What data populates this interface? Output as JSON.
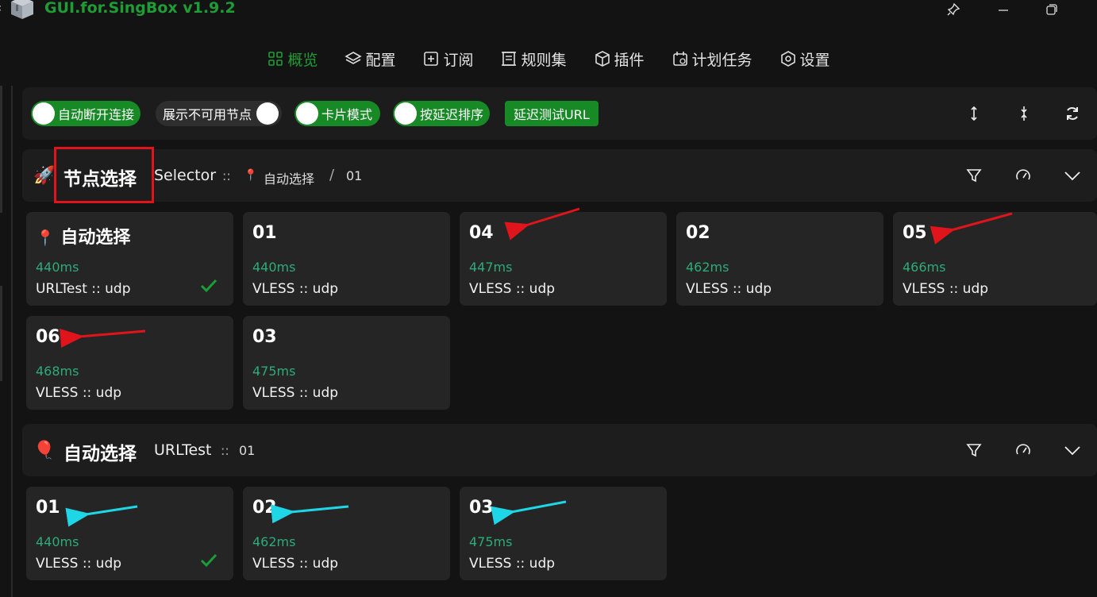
{
  "window": {
    "title": "GUI.for.SingBox v1.9.2"
  },
  "nav": {
    "items": [
      {
        "label": "概览",
        "active": true
      },
      {
        "label": "配置"
      },
      {
        "label": "订阅"
      },
      {
        "label": "规则集"
      },
      {
        "label": "插件"
      },
      {
        "label": "计划任务"
      },
      {
        "label": "设置"
      }
    ]
  },
  "toolbar": {
    "auto_disconnect": {
      "label": "自动断开连接",
      "on": true
    },
    "show_unavailable": {
      "label": "展示不可用节点",
      "on": false
    },
    "card_mode": {
      "label": "卡片模式",
      "on": true
    },
    "sort_by_delay": {
      "label": "按延迟排序",
      "on": true
    },
    "delay_test_url": "延迟测试URL"
  },
  "groups": [
    {
      "emoji": "🚀",
      "name": "节点选择",
      "type": "Selector",
      "separator": "::",
      "crumb_emoji": "📍",
      "crumb_group": "自动选择",
      "crumb_slash": "/",
      "crumb_node": "01",
      "cards": [
        {
          "emoji": "📍",
          "name": "自动选择",
          "delay": "440ms",
          "type": "URLTest :: udp",
          "selected": true
        },
        {
          "name": "01",
          "delay": "440ms",
          "type": "VLESS :: udp"
        },
        {
          "name": "04",
          "delay": "447ms",
          "type": "VLESS :: udp"
        },
        {
          "name": "02",
          "delay": "462ms",
          "type": "VLESS :: udp"
        },
        {
          "name": "05",
          "delay": "466ms",
          "type": "VLESS :: udp"
        },
        {
          "name": "06",
          "delay": "468ms",
          "type": "VLESS :: udp"
        },
        {
          "name": "03",
          "delay": "475ms",
          "type": "VLESS :: udp"
        }
      ]
    },
    {
      "emoji": "🎈",
      "name": "自动选择",
      "type": "URLTest",
      "separator": "::",
      "crumb_node": "01",
      "cards": [
        {
          "name": "01",
          "delay": "440ms",
          "type": "VLESS :: udp",
          "selected": true
        },
        {
          "name": "02",
          "delay": "462ms",
          "type": "VLESS :: udp"
        },
        {
          "name": "03",
          "delay": "475ms",
          "type": "VLESS :: udp"
        }
      ]
    }
  ],
  "colors": {
    "accent": "#178a26",
    "delay": "#2eab7c",
    "annotation_red": "#e0141b",
    "annotation_cyan": "#1fd6e6"
  }
}
